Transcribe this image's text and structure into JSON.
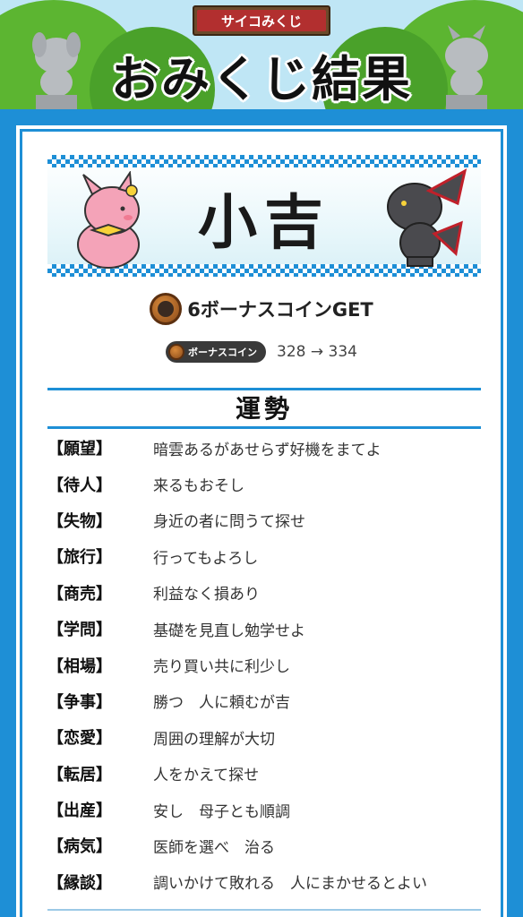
{
  "header": {
    "sign_label": "サイコみくじ",
    "title": "おみくじ結果"
  },
  "result": {
    "fortune": "小吉",
    "bonus_text": "6ボーナスコインGET",
    "coin_badge_label": "ボーナスコイン",
    "balance_change": "328 → 334"
  },
  "section_title": "運勢",
  "items": [
    {
      "category": "【願望】",
      "text": "暗雲あるがあせらず好機をまてよ"
    },
    {
      "category": "【待人】",
      "text": "来るもおそし"
    },
    {
      "category": "【失物】",
      "text": "身近の者に問うて探せ"
    },
    {
      "category": "【旅行】",
      "text": "行ってもよろし"
    },
    {
      "category": "【商売】",
      "text": "利益なく損あり"
    },
    {
      "category": "【学問】",
      "text": "基礎を見直し勉学せよ"
    },
    {
      "category": "【相場】",
      "text": "売り買い共に利少し"
    },
    {
      "category": "【争事】",
      "text": "勝つ　人に頼むが吉"
    },
    {
      "category": "【恋愛】",
      "text": "周囲の理解が大切"
    },
    {
      "category": "【転居】",
      "text": "人をかえて探せ"
    },
    {
      "category": "【出産】",
      "text": "安し　母子とも順調"
    },
    {
      "category": "【病気】",
      "text": "医師を選べ　治る"
    },
    {
      "category": "【縁談】",
      "text": "調いかけて敗れる　人にまかせるとよい"
    }
  ],
  "colors": {
    "accent_blue": "#1e8fd6",
    "sign_red": "#b22f2f",
    "hill_green": "#5cb531"
  },
  "icons": [
    "coin-icon",
    "pink-mascot",
    "dark-dragon-mascot",
    "statue-left",
    "statue-right"
  ]
}
